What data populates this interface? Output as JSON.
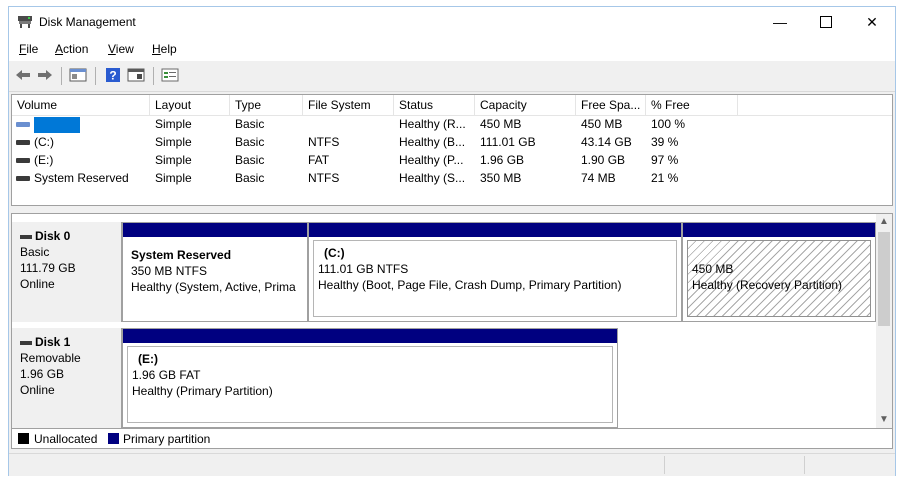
{
  "window": {
    "title": "Disk Management"
  },
  "menu": [
    "File",
    "Action",
    "View",
    "Help"
  ],
  "menu_underline": [
    "F",
    "A",
    "V",
    "H"
  ],
  "menu_rest": [
    "ile",
    "ction",
    "iew",
    "elp"
  ],
  "columns": [
    "Volume",
    "Layout",
    "Type",
    "File System",
    "Status",
    "Capacity",
    "Free Spa...",
    "% Free"
  ],
  "volumes": [
    {
      "volume": "",
      "layout": "Simple",
      "type": "Basic",
      "fs": "",
      "status": "Healthy (R...",
      "capacity": "450 MB",
      "free": "450 MB",
      "pct": "100 %"
    },
    {
      "volume": "(C:)",
      "layout": "Simple",
      "type": "Basic",
      "fs": "NTFS",
      "status": "Healthy (B...",
      "capacity": "111.01 GB",
      "free": "43.14 GB",
      "pct": "39 %"
    },
    {
      "volume": "(E:)",
      "layout": "Simple",
      "type": "Basic",
      "fs": "FAT",
      "status": "Healthy (P...",
      "capacity": "1.96 GB",
      "free": "1.90 GB",
      "pct": "97 %"
    },
    {
      "volume": "System Reserved",
      "layout": "Simple",
      "type": "Basic",
      "fs": "NTFS",
      "status": "Healthy (S...",
      "capacity": "350 MB",
      "free": "74 MB",
      "pct": "21 %"
    }
  ],
  "disks": [
    {
      "name": "Disk 0",
      "type": "Basic",
      "size": "111.79 GB",
      "state": "Online",
      "partitions": [
        {
          "name": "System Reserved",
          "size": "350 MB NTFS",
          "status": "Healthy (System, Active, Prima"
        },
        {
          "name": "(C:)",
          "size": "111.01 GB NTFS",
          "status": "Healthy (Boot, Page File, Crash Dump, Primary Partition)"
        },
        {
          "name": "",
          "size": "450 MB",
          "status": "Healthy (Recovery Partition)"
        }
      ]
    },
    {
      "name": "Disk 1",
      "type": "Removable",
      "size": "1.96 GB",
      "state": "Online",
      "partitions": [
        {
          "name": "(E:)",
          "size": "1.96 GB FAT",
          "status": "Healthy (Primary Partition)"
        }
      ]
    }
  ],
  "legend": [
    {
      "label": "Unallocated",
      "color": "#000000"
    },
    {
      "label": "Primary partition",
      "color": "#000080"
    }
  ],
  "colors": {
    "partition_bar": "#000080",
    "selection": "#0078d7"
  },
  "icons": [
    "disk-management-icon",
    "back-arrow-icon",
    "forward-arrow-icon",
    "properties-icon",
    "help-icon",
    "refresh-view-icon",
    "console-tree-icon"
  ]
}
